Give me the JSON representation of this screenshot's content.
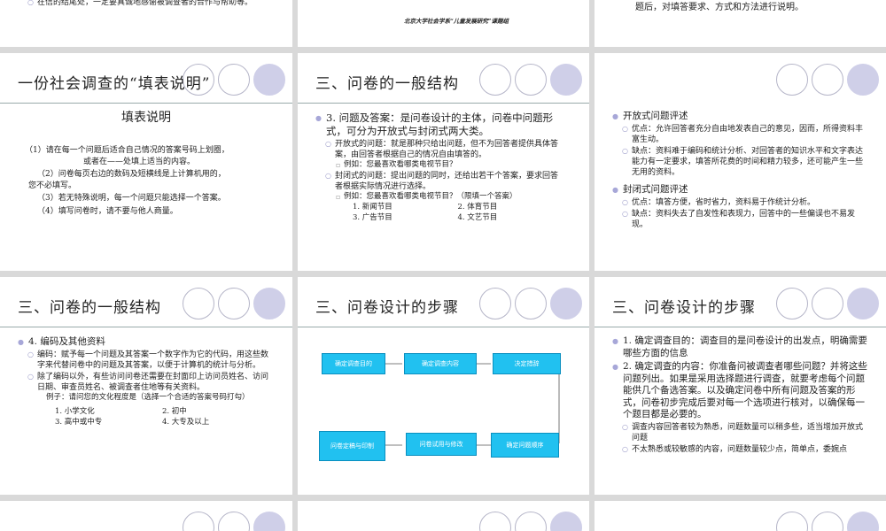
{
  "row0": {
    "slide1_text": "在信的结尾处，一定要真诚地感谢被调查者的合作与帮助等。",
    "slide2_text": "北京大学社会学系“儿童发展研究”课题组",
    "slide3_text": "题后，对填答要求、方式和方法进行说明。"
  },
  "slide_fill": {
    "title": "一份社会调查的“填表说明”",
    "subtitle": "填表说明",
    "items": [
      "（1）请在每一个问题后适合自己情况的答案号码上划圈，",
      "或者在——处填上适当的内容。",
      "（2）问卷每页右边的数码及短横线是上计算机用的，",
      "您不必填写。",
      "（3）若无特殊说明，每一个问题只能选择一个答案。",
      "（4）填写问卷时，请不要与他人商量。"
    ]
  },
  "slide_qa": {
    "title": "三、问卷的一般结构",
    "main": "3. 问题及答案：是问卷设计的主体，问卷中问题形式，可分为开放式与封闭式两大类。",
    "open": "开放式的问题：就是那种只给出问题，但不为回答者提供具体答案，由回答者根据自己的情况自由填答的。",
    "open_example": "例如：您最喜欢看哪类电视节目？",
    "closed": "封闭式的问题：提出问题的同时，还给出若干个答案，要求回答者根据实际情况进行选择。",
    "closed_example": "例如：您最喜欢看哪类电视节目？（限填一个答案）",
    "options": [
      "1. 新闻节目",
      "2. 体育节目",
      "3. 广告节目",
      "4. 文艺节目"
    ]
  },
  "slide_eval": {
    "open_title": "开放式问题评述",
    "open_pro": "优点：允许回答者充分自由地发表自己的意见，因而，所得资料丰富生动。",
    "open_con": "缺点：资料难于编码和统计分析、对回答者的知识水平和文字表达能力有一定要求，填答所花费的时间和精力较多，还可能产生一些无用的资料。",
    "closed_title": "封闭式问题评述",
    "closed_pro": "优点：填答方便，省时省力，资料易于作统计分析。",
    "closed_con": "缺点：资料失去了自发性和表现力，回答中的一些偏误也不易发现。"
  },
  "slide_code": {
    "title": "三、问卷的一般结构",
    "main": "4. 编码及其他资料",
    "code": "编码：赋予每一个问题及其答案一个数字作为它的代码，用这些数字来代替问卷中的问题及其答案，以便于计算机的统计与分析。",
    "other": "除了编码以外，有些访问问卷还需要在封面印上访问员姓名、访问日期、审查员姓名、被调查者住地等有关资料。",
    "example": "例子：请问您的文化程度是（选择一个合适的答案号码打勾）",
    "options": [
      "1. 小学文化",
      "2. 初中",
      "3. 高中或中专",
      "4. 大专及以上"
    ]
  },
  "slide_flow": {
    "title": "三、问卷设计的步骤",
    "boxes": [
      "确定调查目的",
      "确定调查内容",
      "决定措辞",
      "问卷定稿与印制",
      "问卷试用与修改",
      "确定问题顺序"
    ]
  },
  "slide_steps": {
    "title": "三、问卷设计的步骤",
    "step1": "1. 确定调查目的：调查目的是问卷设计的出发点，明确需要哪些方面的信息",
    "step2": "2. 确定调查的内容：你准备问被调查者哪些问题？并将这些问题列出。如果是采用选择题进行调查，就要考虑每个问题能供几个备选答案。以及确定问卷中所有问题及答案的形式，问卷初步完成后要对每一个选项进行核对，以确保每一个题目都是必要的。",
    "sub1": "调查内容回答者较为熟悉，问题数量可以稍多些，适当增加开放式问题",
    "sub2": "不太熟悉或较敏感的内容，问题数量较少点，简单点，委婉点"
  },
  "colors": {
    "accent": "#cfcfe8",
    "flow_box": "#21c1f0",
    "bg": "#d9d9d9"
  }
}
